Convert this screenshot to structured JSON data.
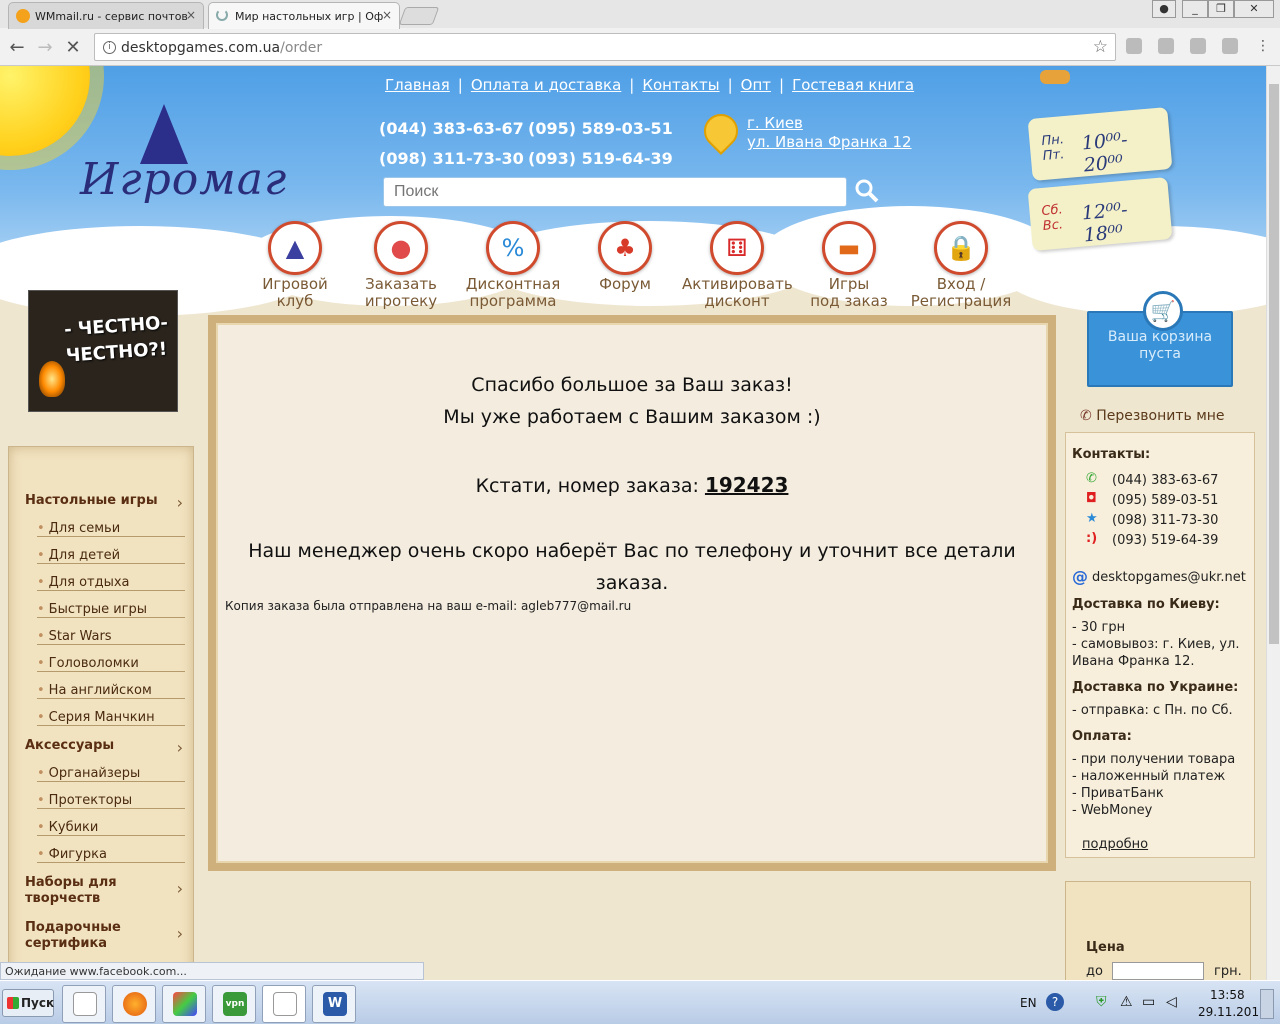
{
  "browser": {
    "tabs": [
      {
        "title": "WMmail.ru - сервис почтов",
        "close": "×"
      },
      {
        "title": "Мир настольных игр | Оф",
        "close": "×"
      }
    ],
    "url_domain": "desktopgames.com.ua",
    "url_path": "/order",
    "status_text": "Ожидание www.facebook.com..."
  },
  "site": {
    "logo": "Игромаг",
    "top_nav": [
      "Главная",
      "Оплата и доставка",
      "Контакты",
      "Опт",
      "Гостевая книга"
    ],
    "phones": [
      "(044) 383-63-67",
      "(095) 589-03-51",
      "(098) 311-73-30",
      "(093) 519-64-39"
    ],
    "address_city": "г. Киев",
    "address_street": "ул. Ивана Франка 12",
    "search_placeholder": "Поиск",
    "hours": {
      "weekday_days": "Пн. Пт.",
      "weekday_time": "10⁰⁰- 20⁰⁰",
      "weekend_days": "Сб. Вс.",
      "weekend_time": "12⁰⁰- 18⁰⁰"
    },
    "categories": [
      {
        "line1": "Игровой",
        "line2": "клуб",
        "icon": "wizard-hat-icon",
        "color": "#3b3fa0"
      },
      {
        "line1": "Заказать",
        "line2": "игротеку",
        "icon": "balloons-icon",
        "color": "#e04a4a"
      },
      {
        "line1": "Дисконтная",
        "line2": "программа",
        "icon": "percent-icon",
        "color": "#2a8ad8"
      },
      {
        "line1": "Форум",
        "line2": "",
        "icon": "meeples-icon",
        "color": "#d83a2a"
      },
      {
        "line1": "Активировать",
        "line2": "дисконт",
        "icon": "dice-icon",
        "color": "#d82a2a"
      },
      {
        "line1": "Игры",
        "line2": "под заказ",
        "icon": "truck-icon",
        "color": "#e06a1a"
      },
      {
        "line1": "Вход /",
        "line2": "Регистрация",
        "icon": "padlock-icon",
        "color": "#d83a2a"
      }
    ]
  },
  "left": {
    "banner_line1": "- ЧЕСТНО-",
    "banner_line2": "ЧЕСТНО?!",
    "menu_board_games": "Настольные игры",
    "board_items": [
      "Для семьи",
      "Для детей",
      "Для отдыха",
      "Быстрые игры",
      "Star Wars",
      "Головоломки",
      "На английском",
      "Серия Манчкин"
    ],
    "menu_accessories": "Аксессуары",
    "accessory_items": [
      "Органайзеры",
      "Протекторы",
      "Кубики",
      "Фигурка"
    ],
    "menu_creative_1": "Наборы для",
    "menu_creative_2": "творчеств",
    "menu_gift_1": "Подарочные",
    "menu_gift_2": "сертифика"
  },
  "main": {
    "thanks_line1": "Спасибо большое за Ваш заказ!",
    "thanks_line2": "Мы уже работаем с Вашим заказом :)",
    "order_prefix": "Кстати, номер заказа:",
    "order_number": "192423",
    "manager_line1": "Наш менеджер очень скоро наберёт Вас по телефону и уточнит все детали",
    "manager_line2": "заказа.",
    "copy_note": "Копия заказа была отправлена на ваш e-mail: agleb777@mail.ru"
  },
  "right": {
    "cart_line1": "Ваша корзина",
    "cart_line2": "пуста",
    "callback": "Перезвонить мне",
    "contacts_title": "Контакты:",
    "contact_phones": [
      {
        "number": "(044) 383-63-67",
        "icon": "kyivstar-phone-icon",
        "color": "#3aa83a"
      },
      {
        "number": "(095) 589-03-51",
        "icon": "vodafone-icon",
        "color": "#e02020"
      },
      {
        "number": "(098) 311-73-30",
        "icon": "kyivstar-star-icon",
        "color": "#2a8ad8"
      },
      {
        "number": "(093) 519-64-39",
        "icon": "lifecell-icon",
        "color": "#e02020"
      }
    ],
    "email": "desktopgames@ukr.net",
    "delivery_kyiv_title": "Доставка по Киеву:",
    "delivery_kyiv_1": "- 30 грн",
    "delivery_kyiv_2": "- самовывоз: г. Киев, ул.",
    "delivery_kyiv_3": "Ивана Франка 12.",
    "delivery_ua_title": "Доставка по Украине:",
    "delivery_ua_1": "- отправка: с Пн. по Сб.",
    "payment_title": "Оплата:",
    "payment_items": [
      "- при получении товара",
      "- наложенный платеж",
      "- ПриватБанк",
      "- WebMoney"
    ],
    "more_link": "подробно",
    "price_label": "Цена",
    "price_to": "до",
    "price_unit": "грн."
  },
  "taskbar": {
    "start": "Пуск",
    "lang": "EN",
    "time": "13:58",
    "date": "29.11.2016"
  }
}
